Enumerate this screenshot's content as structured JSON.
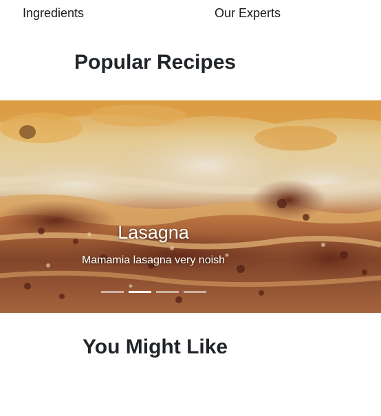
{
  "nav": {
    "items": [
      {
        "label": "Ingredients"
      },
      {
        "label": "Our Experts"
      }
    ]
  },
  "popular": {
    "title": "Popular Recipes"
  },
  "carousel": {
    "slide": {
      "image": "lasagna-photo",
      "title": "Lasagna",
      "description": "Mamamia lasagna very noish"
    },
    "indicator_count": 4,
    "active_index": 1
  },
  "might_like": {
    "title": "You Might Like"
  }
}
